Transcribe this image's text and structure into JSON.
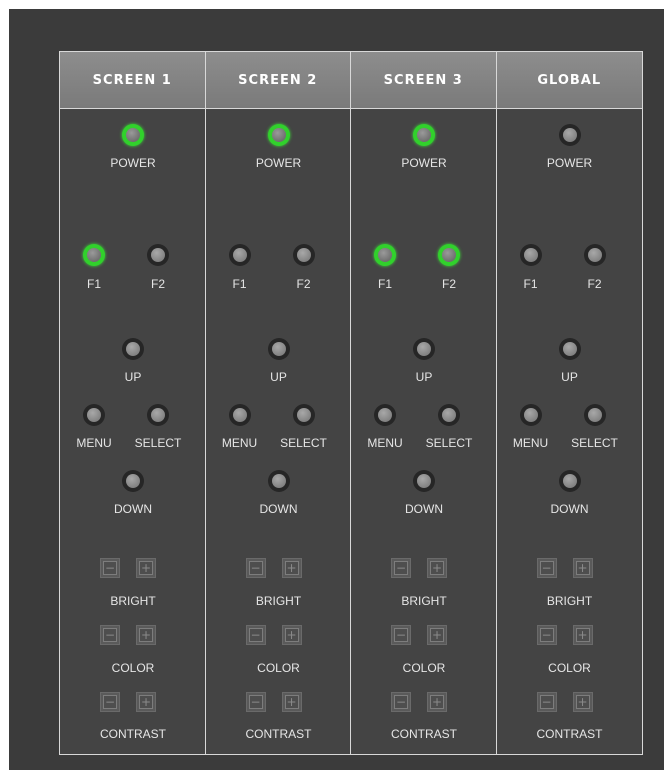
{
  "colors": {
    "background": "#3b3b3b",
    "header": "#848484",
    "led_on": "#31d12c",
    "led_off": "#262626",
    "text": "#e6e6e6"
  },
  "labels": {
    "power": "POWER",
    "f1": "F1",
    "f2": "F2",
    "up": "UP",
    "menu": "MENU",
    "select": "SELECT",
    "down": "DOWN",
    "bright": "BRIGHT",
    "color": "COLOR",
    "contrast": "CONTRAST",
    "minus": "−",
    "plus": "+"
  },
  "columns": [
    {
      "title": "SCREEN 1",
      "power_on": true,
      "f1_on": true,
      "f2_on": false
    },
    {
      "title": "SCREEN 2",
      "power_on": true,
      "f1_on": false,
      "f2_on": false
    },
    {
      "title": "SCREEN 3",
      "power_on": true,
      "f1_on": true,
      "f2_on": true
    },
    {
      "title": "GLOBAL",
      "power_on": false,
      "f1_on": false,
      "f2_on": false
    }
  ]
}
